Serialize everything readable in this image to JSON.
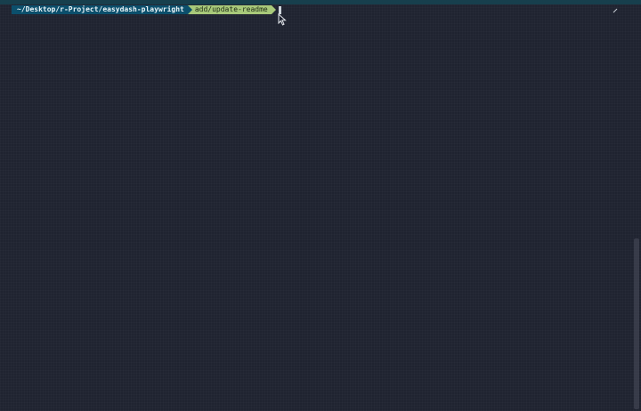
{
  "prompt": {
    "path": "~/Desktop/r-Project/easydash-playwright",
    "branch": "add/update-readme"
  },
  "colors": {
    "background": "#1f2330",
    "path_segment": "#0b4f6c",
    "branch_segment": "#a8c97a",
    "cursor": "#cfd6dc"
  },
  "icons": {
    "pointer": "mouse-pointer-icon",
    "resize": "resize-icon"
  }
}
